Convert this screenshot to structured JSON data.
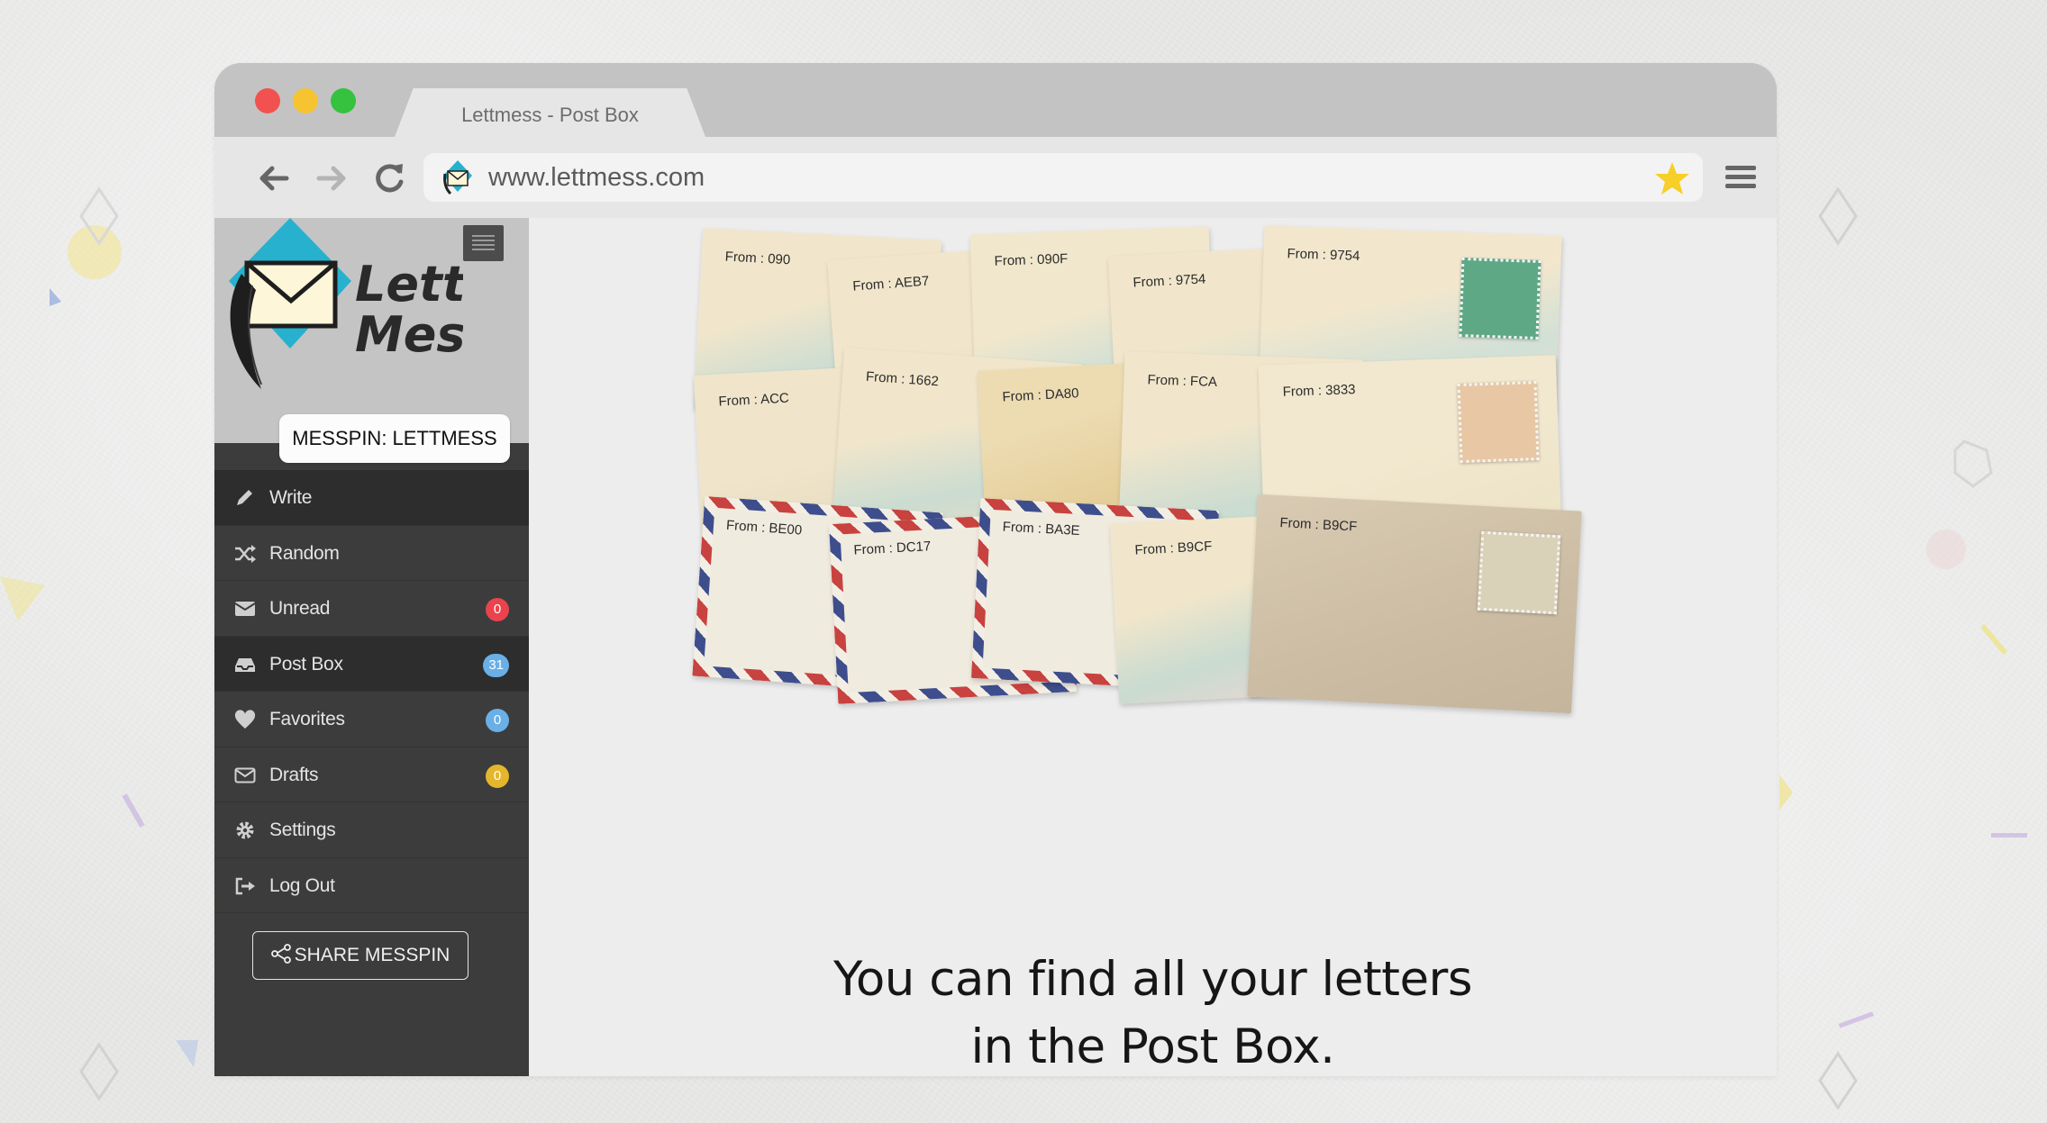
{
  "browser": {
    "tab_title": "Lettmess - Post Box",
    "url": "www.lettmess.com"
  },
  "sidebar": {
    "messpin_label": "MESSPIN: LETTMESS",
    "items": [
      {
        "label": "Write",
        "icon": "pencil-icon"
      },
      {
        "label": "Random",
        "icon": "shuffle-icon"
      },
      {
        "label": "Unread",
        "icon": "envelope-icon",
        "badge": "0",
        "badge_color": "#e9444e"
      },
      {
        "label": "Post Box",
        "icon": "inbox-icon",
        "badge": "31",
        "badge_color": "#6aafe6"
      },
      {
        "label": "Favorites",
        "icon": "heart-icon",
        "badge": "0",
        "badge_color": "#6aafe6"
      },
      {
        "label": "Drafts",
        "icon": "envelope-outline-icon",
        "badge": "0",
        "badge_color": "#e4b62c"
      },
      {
        "label": "Settings",
        "icon": "gear-icon"
      },
      {
        "label": "Log Out",
        "icon": "logout-icon"
      }
    ],
    "share_label": "SHARE MESSPIN"
  },
  "envelopes": [
    {
      "from": "From : 090"
    },
    {
      "from": "From : AEB7"
    },
    {
      "from": "From : 090F"
    },
    {
      "from": "From : 9754"
    },
    {
      "from": "From : 9754"
    },
    {
      "from": "From : ACC"
    },
    {
      "from": "From : 1662"
    },
    {
      "from": "From : DA80"
    },
    {
      "from": "From : FCA"
    },
    {
      "from": "From : 3833"
    },
    {
      "from": "From : BE00"
    },
    {
      "from": "From : DC17"
    },
    {
      "from": "From : BA3E"
    },
    {
      "from": "From : B9CF"
    },
    {
      "from": "From : B9CF"
    }
  ],
  "tagline": {
    "line1": "You can find all your letters",
    "line2": "in the Post Box."
  },
  "colors": {
    "sidebar_bg": "#3c3c3c",
    "sidebar_active": "#2d2d2d",
    "logo_blue": "#27b1cf"
  }
}
